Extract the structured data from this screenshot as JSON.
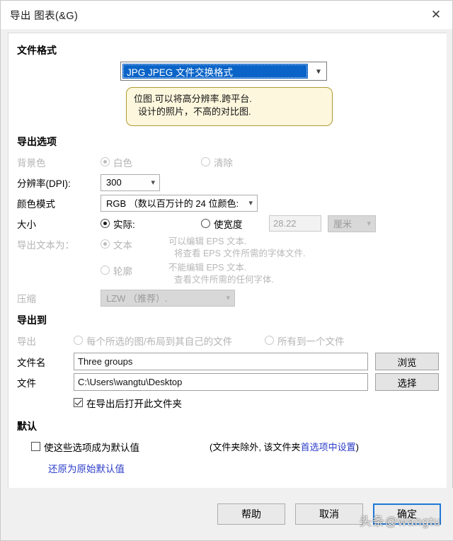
{
  "window": {
    "title": "导出 图表(&G)",
    "close_icon": "close-icon"
  },
  "file_format": {
    "heading": "文件格式",
    "selected": "JPG JPEG 文件交换格式",
    "dropdown_icon": "chevron-down-icon",
    "description_line1": "位图.可以将高分辨率.跨平台.",
    "description_line2": "设计的照片，不高的对比图."
  },
  "export_options": {
    "heading": "导出选项",
    "background": {
      "label": "背景色",
      "white_label": "白色",
      "white_selected": true,
      "clear_label": "清除",
      "clear_selected": false,
      "disabled": true
    },
    "resolution": {
      "label": "分辨率(DPI):",
      "value": "300"
    },
    "color_mode": {
      "label": "颜色模式",
      "value": "RGB （数以百万计的 24 位颜色:"
    },
    "size": {
      "label": "大小",
      "actual_label": "实际:",
      "actual_selected": true,
      "width_label": "使宽度",
      "width_selected": false,
      "width_value": "28.22",
      "unit_value": "厘米"
    },
    "export_text_as": {
      "label": "导出文本为：",
      "text_label": "文本",
      "text_selected": true,
      "text_hint1": "可以编辑 EPS 文本.",
      "text_hint2": "将查看 EPS 文件所需的字体文件.",
      "outline_label": "轮廓",
      "outline_selected": false,
      "outline_hint1": "不能编辑 EPS 文本.",
      "outline_hint2": "查看文件所需的任何字体."
    },
    "compression": {
      "label": "压缩",
      "value": "LZW （推荐）."
    }
  },
  "export_to": {
    "heading": "导出到",
    "export_label": "导出",
    "per_file_label": "每个所选的图/布局到其自己的文件",
    "per_file_selected": false,
    "all_one_label": "所有到一个文件",
    "all_one_selected": false,
    "filename_label": "文件名",
    "filename_value": "Three groups",
    "browse_label": "浏览",
    "folder_label": "文件",
    "folder_value": "C:\\Users\\wangtu\\Desktop",
    "select_label": "选择",
    "open_after_label": "在导出后打开此文件夹",
    "open_after_checked": true
  },
  "defaults": {
    "heading": "默认",
    "make_default_label": "使这些选项成为默认值",
    "make_default_checked": false,
    "note_prefix": "(文件夹除外, 该文件夹",
    "note_link": "首选项中设置",
    "note_suffix": ")",
    "restore_link": "还原为原始默认值"
  },
  "footer": {
    "help_label": "帮助",
    "cancel_label": "取消",
    "ok_label": "确定"
  },
  "watermark": {
    "text": "头条@wangtu"
  },
  "colors": {
    "accent_blue": "#0a64c8",
    "link_blue": "#2b3cc8",
    "focus_blue": "#1e78d7",
    "tooltip_bg": "#fdf7dd",
    "tooltip_border": "#b09a30",
    "disabled_text": "#b4b4b4"
  }
}
